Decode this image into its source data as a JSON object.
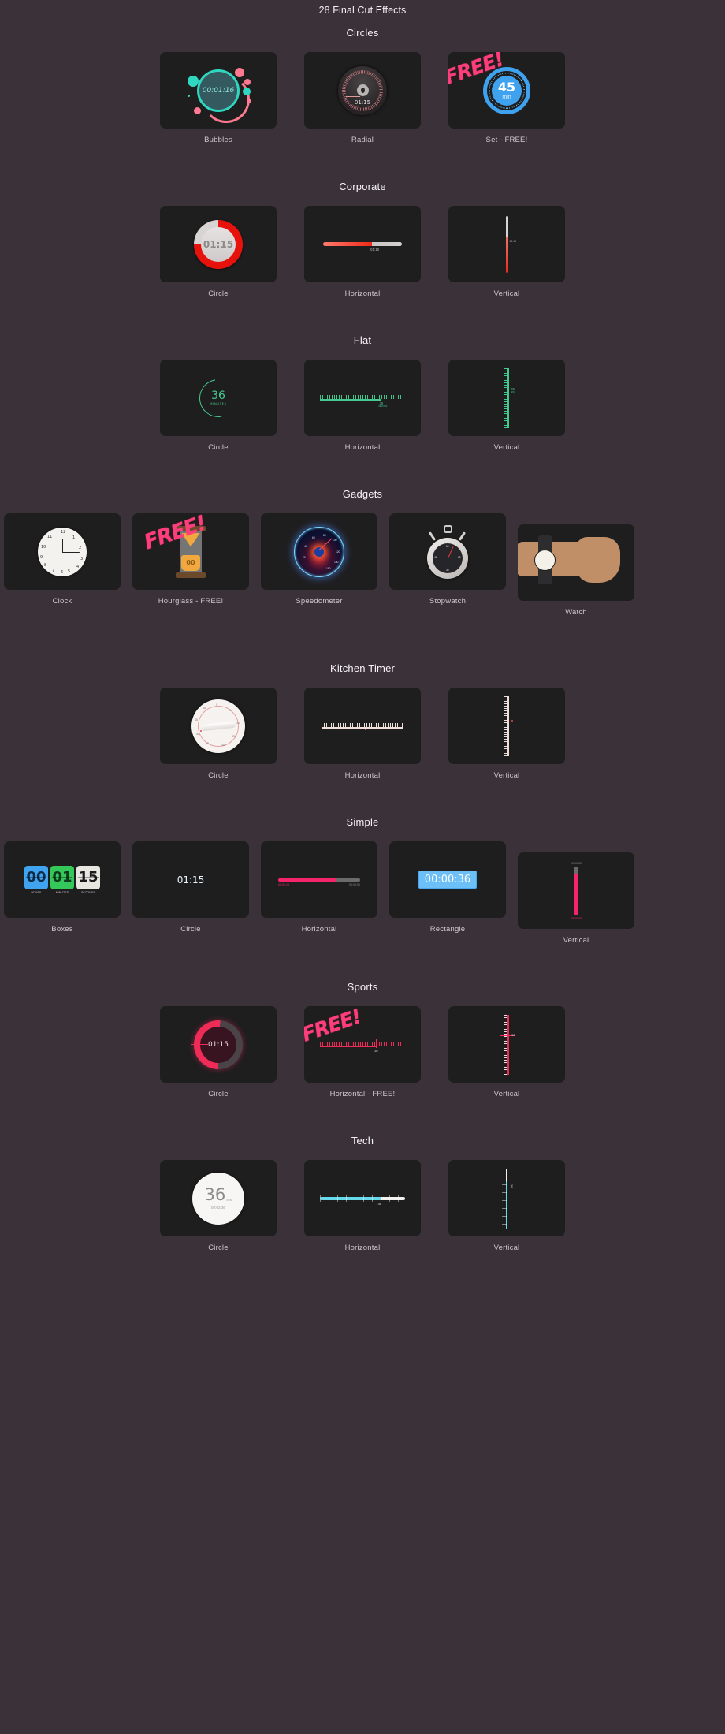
{
  "page": {
    "title": "28 Final Cut Effects",
    "background_color": "#3b3139",
    "card_color": "#1f1e1f",
    "caption_color": "#cdc6d0",
    "free_badge_color": "#ff3d7a",
    "free_badge_text": "FREE!"
  },
  "sections": [
    {
      "title": "Circles",
      "columns": 3,
      "items": [
        {
          "caption": "Bubbles",
          "preview_text": "00:01:16",
          "free": false,
          "accent": "#2fd6c0"
        },
        {
          "caption": "Radial",
          "preview_text": "01:15",
          "free": false,
          "accent": "#c9797e"
        },
        {
          "caption": "Set - FREE!",
          "preview_text": "45",
          "preview_unit": "min",
          "free": true,
          "accent": "#3ea2ef"
        }
      ]
    },
    {
      "title": "Corporate",
      "columns": 3,
      "items": [
        {
          "caption": "Circle",
          "preview_text": "01:15",
          "free": false,
          "accent": "#e8120c"
        },
        {
          "caption": "Horizontal",
          "preview_text": "01:15",
          "free": false,
          "accent": "#e8120c"
        },
        {
          "caption": "Vertical",
          "preview_text": "01:15",
          "free": false,
          "accent": "#e8120c"
        }
      ]
    },
    {
      "title": "Flat",
      "columns": 3,
      "items": [
        {
          "caption": "Circle",
          "preview_text": "36",
          "preview_unit": "MINUTES",
          "free": false,
          "accent": "#46c98e"
        },
        {
          "caption": "Horizontal",
          "preview_text": "36",
          "preview_unit": "MINUTES",
          "free": false,
          "accent": "#46c98e"
        },
        {
          "caption": "Vertical",
          "preview_text": "36",
          "preview_unit": "MIN",
          "free": false,
          "accent": "#46c98e"
        }
      ]
    },
    {
      "title": "Gadgets",
      "columns": 4,
      "items": [
        {
          "caption": "Clock",
          "free": false,
          "accent": "#f3f2ee"
        },
        {
          "caption": "Hourglass - FREE!",
          "preview_text": "00",
          "free": true,
          "accent": "#f0a83f"
        },
        {
          "caption": "Speedometer",
          "free": false,
          "accent": "#7fd8ff"
        },
        {
          "caption": "Stopwatch",
          "free": false,
          "accent": "#e03a3a"
        },
        {
          "caption": "Watch",
          "free": false,
          "accent": "#c08f67"
        }
      ]
    },
    {
      "title": "Kitchen Timer",
      "columns": 3,
      "items": [
        {
          "caption": "Circle",
          "free": false,
          "accent": "#e8a0a0"
        },
        {
          "caption": "Horizontal",
          "free": false,
          "accent": "#f0d8d4"
        },
        {
          "caption": "Vertical",
          "free": false,
          "accent": "#f0d8d4"
        }
      ]
    },
    {
      "title": "Simple",
      "columns": 4,
      "items": [
        {
          "caption": "Boxes",
          "free": false,
          "accent": "#3fa3f0",
          "boxes": [
            {
              "value": "00",
              "label": "HOURS",
              "color": "#3fa3f0"
            },
            {
              "value": "01",
              "label": "MINUTES",
              "color": "#34c759"
            },
            {
              "value": "15",
              "label": "SECONDS",
              "color": "#e8e6e1"
            }
          ]
        },
        {
          "caption": "Circle",
          "preview_text": "01:15",
          "free": false,
          "accent": "#4aa8f0"
        },
        {
          "caption": "Horizontal",
          "preview_text": "00:01:15",
          "preview_text_2": "00:00:00",
          "free": false,
          "accent": "#f5246b"
        },
        {
          "caption": "Rectangle",
          "preview_text": "00:00:36",
          "free": false,
          "accent": "#6cc0f7"
        },
        {
          "caption": "Vertical",
          "preview_text": "00:00:02",
          "preview_text_2": "00:00:05",
          "free": false,
          "accent": "#f5246b"
        }
      ]
    },
    {
      "title": "Sports",
      "columns": 3,
      "items": [
        {
          "caption": "Circle",
          "preview_text": "01:15",
          "free": false,
          "accent": "#ef2b58"
        },
        {
          "caption": "Horizontal - FREE!",
          "preview_text": "36",
          "free": true,
          "accent": "#ef2b58"
        },
        {
          "caption": "Vertical",
          "preview_text": "36",
          "free": false,
          "accent": "#ef2b58"
        }
      ]
    },
    {
      "title": "Tech",
      "columns": 3,
      "items": [
        {
          "caption": "Circle",
          "preview_text": "36",
          "preview_unit": "MIN",
          "preview_text_2": "00:02:36",
          "free": false,
          "accent": "#1565a8"
        },
        {
          "caption": "Horizontal",
          "preview_text": "36",
          "free": false,
          "accent": "#31c7e8"
        },
        {
          "caption": "Vertical",
          "preview_text": "36",
          "free": false,
          "accent": "#31c7e8"
        }
      ]
    }
  ]
}
